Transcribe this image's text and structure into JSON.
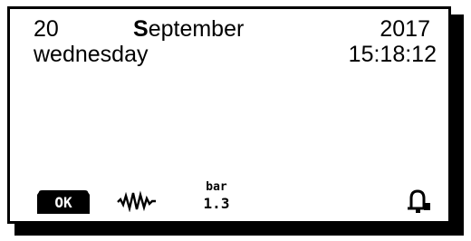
{
  "display": {
    "date": {
      "day": "20",
      "month_first_letter": "S",
      "month_rest": "eptember",
      "year": "2017"
    },
    "weekday": "wednesday",
    "time": "15:18:12"
  },
  "icons": {
    "ok_label": "OK",
    "pressure_unit": "bar",
    "pressure_value": "1.3",
    "names": [
      "ok-button-icon",
      "waveform-icon",
      "pressure-bar-icon",
      "bell-icon"
    ]
  },
  "colors": {
    "background": "#ffffff",
    "foreground": "#000000"
  }
}
